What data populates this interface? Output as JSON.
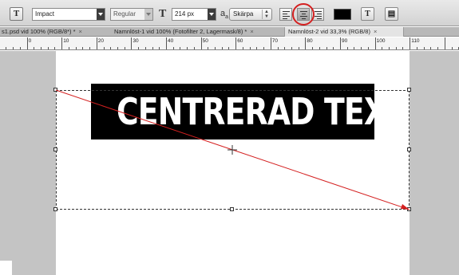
{
  "options_bar": {
    "tool_glyph": "T",
    "font_family": "Impact",
    "font_style": "Regular",
    "font_size_glyph": "T",
    "font_size": "214 px",
    "antialias_glyph": "a",
    "antialias_sub": "a",
    "antialias": "Skärpa",
    "align_buttons": [
      "align-left",
      "align-center",
      "align-right"
    ],
    "active_align": "align-center",
    "text_color": "#000000",
    "warp_glyph": "T"
  },
  "tabs": [
    {
      "label": "s1.psd vid 100% (RGB/8*) *",
      "close": "×"
    },
    {
      "label": "Namnlöst-1 vid 100% (Fotofilter 2, Lagermask/8) *",
      "close": "×"
    },
    {
      "label": "Namnlöst-2 vid 33,3% (RGB/8)",
      "close": "×",
      "active": true
    }
  ],
  "ruler": {
    "labels": [
      "10",
      "0",
      "10",
      "20",
      "30",
      "40",
      "50",
      "60",
      "70",
      "80",
      "90",
      "100",
      "110"
    ]
  },
  "canvas": {
    "text": "CENTRERAD TEXT",
    "banner_color": "#000000",
    "annotation_color": "#d42020"
  }
}
